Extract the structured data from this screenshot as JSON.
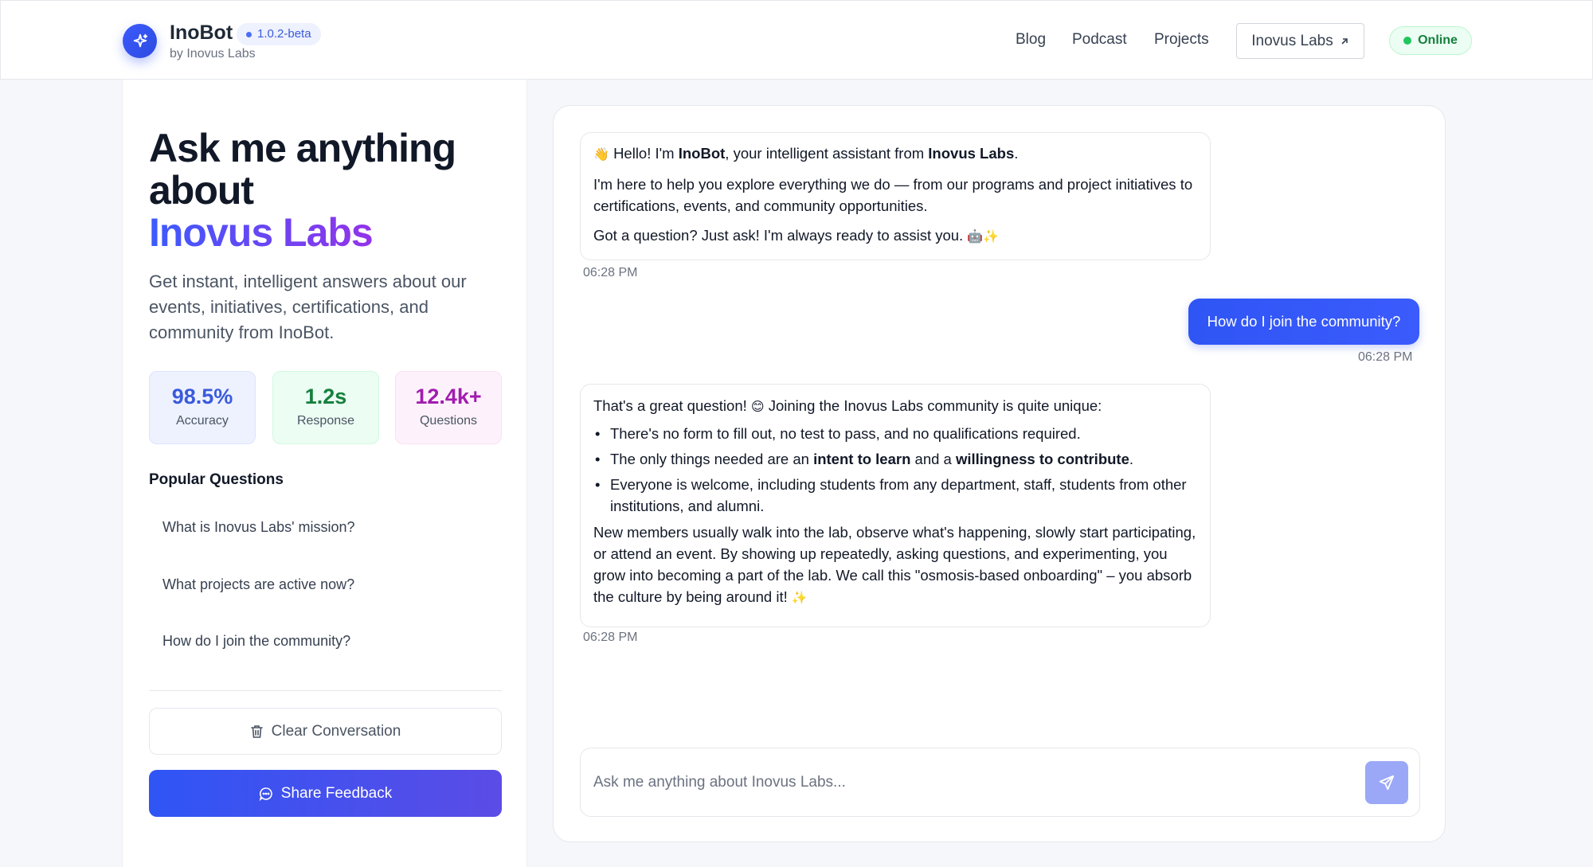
{
  "header": {
    "brand": "InoBot",
    "version": "1.0.2-beta",
    "byline": "by Inovus Labs",
    "nav": [
      "Blog",
      "Podcast",
      "Projects"
    ],
    "external_link": "Inovus Labs",
    "status": "Online"
  },
  "sidebar": {
    "title_line1": "Ask me anything",
    "title_line2": "about",
    "title_accent": "Inovus Labs",
    "description": "Get instant, intelligent answers about our events, initiatives, certifications, and community from InoBot.",
    "stats": [
      {
        "value": "98.5%",
        "label": "Accuracy"
      },
      {
        "value": "1.2s",
        "label": "Response"
      },
      {
        "value": "12.4k+",
        "label": "Questions"
      }
    ],
    "popular_heading": "Popular Questions",
    "popular_questions": [
      "What is Inovus Labs' mission?",
      "What projects are active now?",
      "How do I join the community?"
    ],
    "clear_label": "Clear Conversation",
    "feedback_label": "Share Feedback"
  },
  "chat": {
    "bot1": {
      "greet_pre": "Hello! I'm ",
      "greet_bot": "InoBot",
      "greet_mid": ", your intelligent assistant from ",
      "greet_org": "Inovus Labs",
      "greet_end": ".",
      "para2": "I'm here to help you explore everything we do — from our programs and project initiatives to certifications, events, and community opportunities.",
      "para3": "Got a question? Just ask! I'm always ready to assist you.",
      "time": "06:28 PM"
    },
    "user1": {
      "text": "How do I join the community?",
      "time": "06:28 PM"
    },
    "bot2": {
      "intro_pre": "That's a great question! ",
      "intro_post": " Joining the Inovus Labs community is quite unique:",
      "bullet1": "There's no form to fill out, no test to pass, and no qualifications required.",
      "bullet2_pre": "The only things needed are an ",
      "bullet2_b1": "intent to learn",
      "bullet2_mid": " and a ",
      "bullet2_b2": "willingness to contribute",
      "bullet2_end": ".",
      "bullet3": "Everyone is welcome, including students from any department, staff, students from other institutions, and alumni.",
      "para": "New members usually walk into the lab, observe what's happening, slowly start participating, or attend an event. By showing up repeatedly, asking questions, and experimenting, you grow into becoming a part of the lab. We call this \"osmosis-based onboarding\" – you absorb the culture by being around it!",
      "time": "06:28 PM"
    },
    "input_placeholder": "Ask me anything about Inovus Labs..."
  }
}
